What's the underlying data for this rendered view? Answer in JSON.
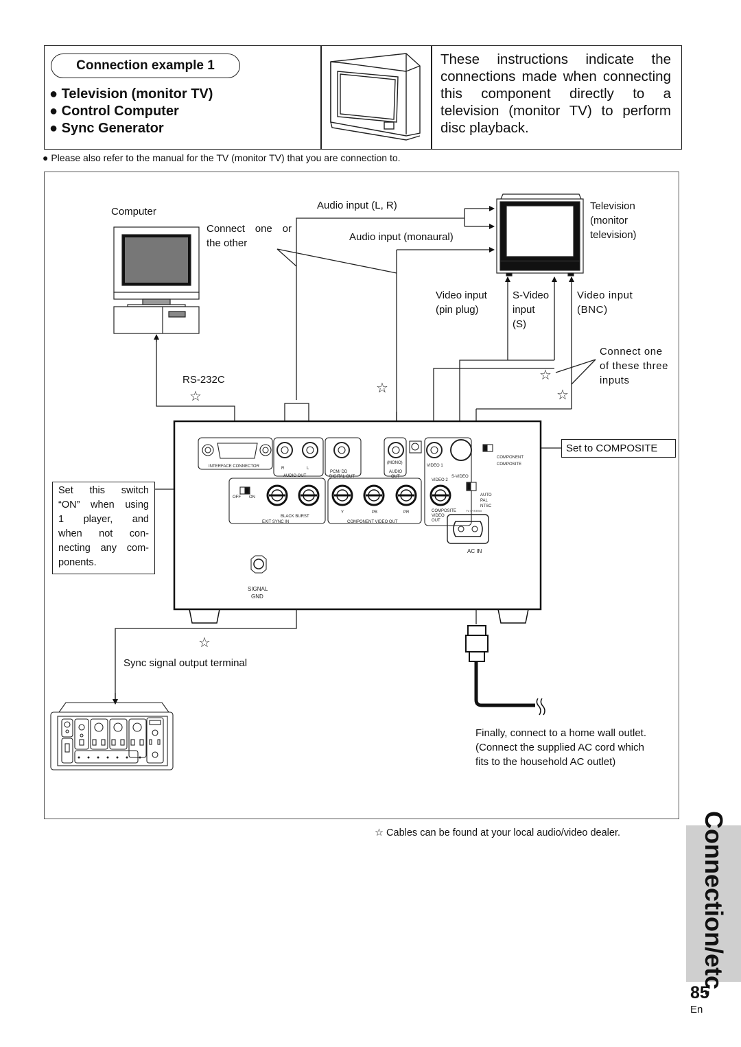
{
  "header": {
    "badge": "Connection example 1",
    "bullets": [
      "Television (monitor TV)",
      "Control Computer",
      "Sync Generator"
    ],
    "bullet_glyph": "●",
    "intro": "These instructions indicate the connections made when connecting this component directly to a television (monitor TV) to perform disc playback."
  },
  "note": "● Please also refer to the manual for the TV (monitor TV) that you are connection to.",
  "diagram": {
    "computer_label": "Computer",
    "connect_one_or_other": "Connect one or the other",
    "audio_lr": "Audio input (L, R)",
    "audio_mono": "Audio input (monaural)",
    "tv_label": [
      "Television",
      "(monitor",
      "television)"
    ],
    "video_pin": [
      "Video input",
      "(pin plug)"
    ],
    "svideo": [
      "S-Video",
      "input",
      "(S)"
    ],
    "video_bnc": [
      "Video input",
      "(BNC)"
    ],
    "connect_three": [
      "Connect one",
      "of these three",
      "inputs"
    ],
    "rs232c": "RS-232C",
    "set_composite": "Set to COMPOSITE",
    "switch_note": [
      "Set this switch",
      "“ON” when using",
      "1 player, and",
      "when not con-",
      "necting any com-",
      "ponents."
    ],
    "sync_output": "Sync signal output terminal",
    "wall_outlet": [
      "Finally, connect to a home wall outlet.",
      "(Connect the supplied AC cord which",
      "fits to the household AC outlet)"
    ],
    "star_glyph": "☆",
    "panel": {
      "interface_connector": "INTERFACE CONNECTOR",
      "r": "R",
      "l": "L",
      "audio_out": "AUDIO OUT",
      "pcm": "PCM/ DD",
      "digital_out": "DIGITAL OUT",
      "mono": "(MONO)",
      "audio": "AUDIO",
      "out": "OUT",
      "video1": "VIDEO 1",
      "svideo": "S-VIDEO",
      "video2": "VIDEO 2",
      "component": "COMPONENT",
      "composite": "COMPOSITE",
      "auto": "AUTO",
      "pal": "PAL",
      "ntsc": "NTSC",
      "tv_system": "TV SYSTEM",
      "off": "OFF",
      "on": "ON",
      "black_burst": "BLACK BURST",
      "exit_sync_in": "EXIT SYNC IN",
      "y": "Y",
      "pb": "PB",
      "pr": "PR",
      "component_video_out": "COMPONENT VIDEO OUT",
      "composite_video_out": [
        "COMPOSITE",
        "VIDEO",
        "OUT"
      ],
      "ac_in": "AC IN",
      "signal_gnd": [
        "SIGNAL",
        "GND"
      ]
    }
  },
  "footer": {
    "cables_note": "☆ Cables can be found at your local audio/video dealer.",
    "section_tab": "Connection/etc.",
    "page_number": "85",
    "language": "En"
  }
}
